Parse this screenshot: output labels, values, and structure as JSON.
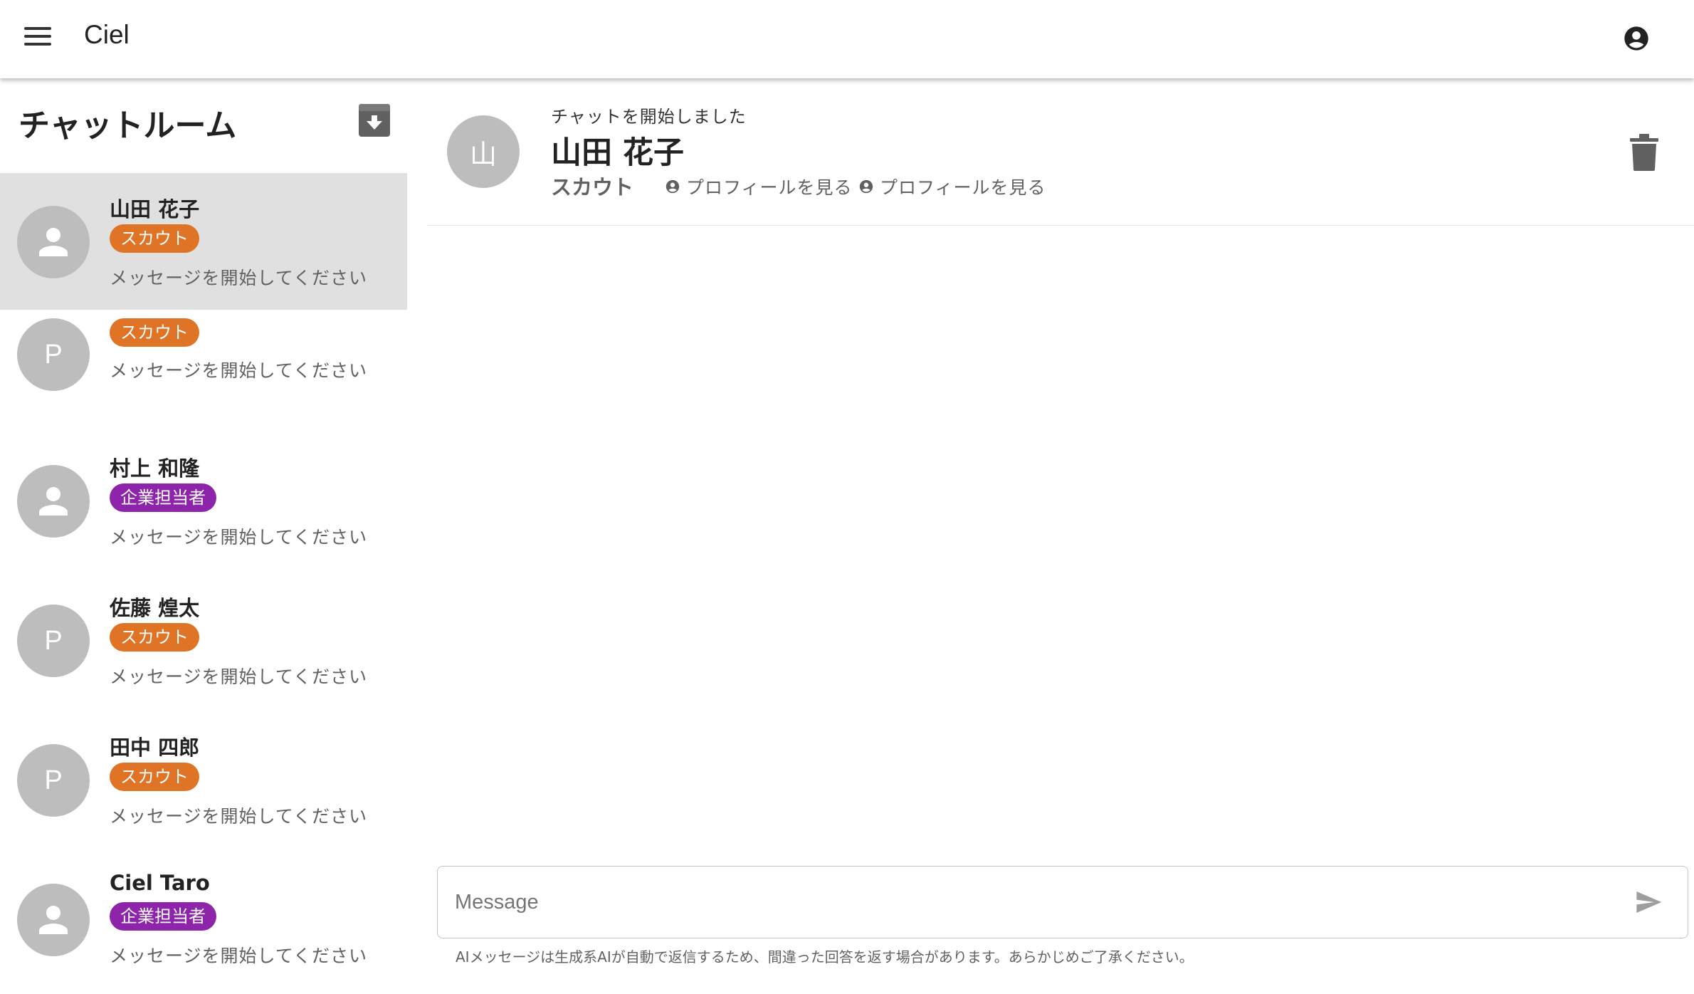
{
  "appbar": {
    "title": "Ciel",
    "menu_icon": "hamburger-menu-icon",
    "account_icon": "account-circle-icon"
  },
  "sidebar": {
    "title": "チャットルーム",
    "archive_icon": "archive-icon",
    "rooms": [
      {
        "name": "山田 花子",
        "role": "スカウト",
        "role_type": "scout",
        "avatar": "person",
        "message": "メッセージを開始してください",
        "selected": true
      },
      {
        "name": "",
        "role": "スカウト",
        "role_type": "scout",
        "avatar": "P",
        "message": "メッセージを開始してください",
        "selected": false
      },
      {
        "name": "村上 和隆",
        "role": "企業担当者",
        "role_type": "company",
        "avatar": "person",
        "message": "メッセージを開始してください",
        "selected": false
      },
      {
        "name": "佐藤 煌太",
        "role": "スカウト",
        "role_type": "scout",
        "avatar": "P",
        "message": "メッセージを開始してください",
        "selected": false
      },
      {
        "name": "田中 四郎",
        "role": "スカウト",
        "role_type": "scout",
        "avatar": "P",
        "message": "メッセージを開始してください",
        "selected": false
      },
      {
        "name": "Ciel Taro",
        "role": "企業担当者",
        "role_type": "company",
        "avatar": "person",
        "message": "メッセージを開始してください",
        "selected": false
      }
    ]
  },
  "chat": {
    "avatar_initial": "山",
    "status": "チャットを開始しました",
    "name": "山田 花子",
    "role": "スカウト",
    "profile_link_1": "プロフィールを見る",
    "profile_link_2": "プロフィールを見る",
    "delete_icon": "trash-icon"
  },
  "composer": {
    "placeholder": "Message",
    "send_icon": "send-icon",
    "disclaimer": "AIメッセージは生成系AIが自動で返信するため、間違った回答を返す場合があります。あらかじめご了承ください。"
  },
  "colors": {
    "scout": "#e07426",
    "company": "#8e24aa",
    "avatar_bg": "#bdbdbd",
    "selected_bg": "#e0e0e0"
  }
}
